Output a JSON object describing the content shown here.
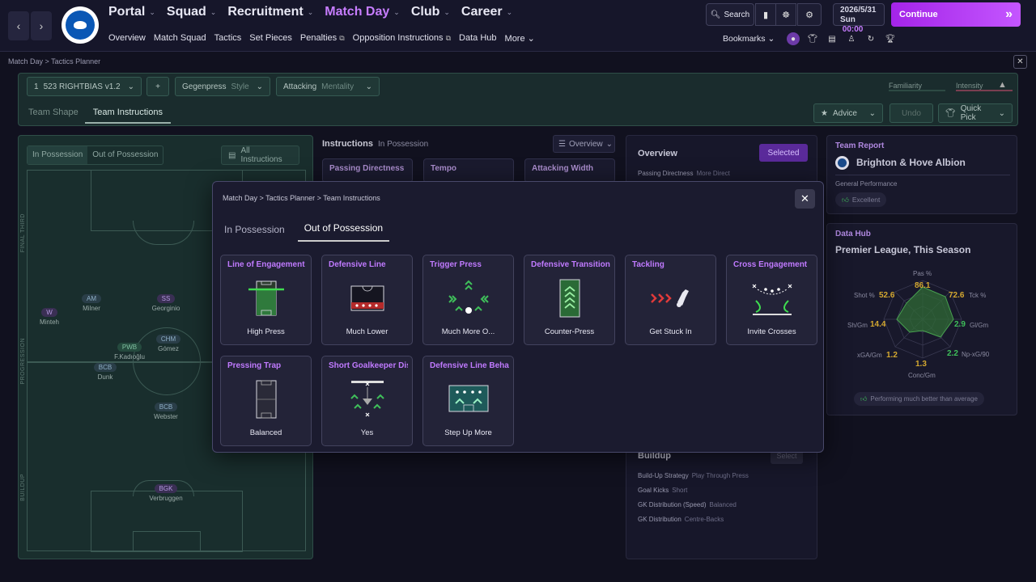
{
  "topnav": {
    "back": "‹",
    "forward": "›",
    "main": [
      {
        "label": "Portal",
        "active": false
      },
      {
        "label": "Squad",
        "active": false
      },
      {
        "label": "Recruitment",
        "active": false
      },
      {
        "label": "Match Day",
        "active": true
      },
      {
        "label": "Club",
        "active": false
      },
      {
        "label": "Career",
        "active": false
      }
    ],
    "sub": [
      "Overview",
      "Match Squad",
      "Tactics",
      "Set Pieces",
      "Penalties",
      "Opposition Instructions",
      "Data Hub",
      "More"
    ],
    "search_label": "Search",
    "date": "2026/5/31",
    "day": "Sun",
    "time": "00:00",
    "continue_label": "Continue",
    "bookmarks_label": "Bookmarks"
  },
  "breadcrumb_top": "Match Day  >  Tactics Planner",
  "planner": {
    "tactic_name": "523 RIGHTBIAS v1.2",
    "add": "+",
    "style_value": "Gegenpress",
    "style_label": "Style",
    "mentality_value": "Attacking",
    "mentality_label": "Mentality",
    "familiarity_label": "Familiarity",
    "intensity_label": "Intensity",
    "tabs": [
      "Team Shape",
      "Team Instructions"
    ],
    "advice_label": "Advice",
    "undo_label": "Undo",
    "quickpick_label": "Quick Pick"
  },
  "pitch": {
    "tabs": [
      "In Possession",
      "Out of Possession"
    ],
    "all_instructions": "All Instructions",
    "zones": [
      "FINAL THIRD",
      "PROGRESSION",
      "BUILDUP"
    ],
    "players": [
      {
        "pos": "W",
        "name": "Minteh"
      },
      {
        "pos": "AM",
        "name": "Milner"
      },
      {
        "pos": "SS",
        "name": "Georginio"
      },
      {
        "pos": "PWB",
        "name": "F.Kadıoğlu"
      },
      {
        "pos": "CHM",
        "name": "Gómez"
      },
      {
        "pos": "BCB",
        "name": "Dunk"
      },
      {
        "pos": "BCB",
        "name": "Webster"
      },
      {
        "pos": "BGK",
        "name": "Verbruggen"
      }
    ]
  },
  "instructions": {
    "title": "Instructions",
    "subtitle": "In Possession",
    "overview_dd": "Overview",
    "bg_cards": [
      "Passing Directness",
      "Tempo",
      "Attacking Width"
    ]
  },
  "overview": {
    "title": "Overview",
    "selected": "Selected",
    "line1_label": "Passing Directness",
    "line1_value": "More Direct",
    "buildup_title": "Buildup",
    "select": "Select",
    "lines": [
      {
        "label": "Build-Up Strategy",
        "value": "Play Through Press"
      },
      {
        "label": "Goal Kicks",
        "value": "Short"
      },
      {
        "label": "GK Distribution (Speed)",
        "value": "Balanced"
      },
      {
        "label": "GK Distribution",
        "value": "Centre-Backs"
      }
    ]
  },
  "team_report": {
    "title": "Team Report",
    "club": "Brighton & Hove Albion",
    "perf_label": "General Performance",
    "perf_value": "Excellent"
  },
  "data_hub": {
    "title": "Data Hub",
    "subtitle": "Premier League, This Season",
    "stats": [
      {
        "label": "Pas %",
        "value": "86.1"
      },
      {
        "label": "Tck %",
        "value": "72.6"
      },
      {
        "label": "Gl/Gm",
        "value": "2.9"
      },
      {
        "label": "Np-xG/90",
        "value": "2.2"
      },
      {
        "label": "Conc/Gm",
        "value": "1.3"
      },
      {
        "label": "xGA/Gm",
        "value": "1.2"
      },
      {
        "label": "Sh/Gm",
        "value": "14.4"
      },
      {
        "label": "Shot %",
        "value": "52.6"
      }
    ],
    "performance_note": "Performing much better than average"
  },
  "modal": {
    "crumbs": "Match Day  >  Tactics Planner  >  Team Instructions",
    "tabs": [
      "In Possession",
      "Out of Possession"
    ],
    "active_tab": 1,
    "cards": [
      {
        "title": "Line of Engagement",
        "value": "High Press",
        "icon": "line-of-engagement-icon"
      },
      {
        "title": "Defensive Line",
        "value": "Much Lower",
        "icon": "defensive-line-icon"
      },
      {
        "title": "Trigger Press",
        "value": "Much More O...",
        "icon": "trigger-press-icon"
      },
      {
        "title": "Defensive Transition",
        "value": "Counter-Press",
        "icon": "defensive-transition-icon"
      },
      {
        "title": "Tackling",
        "value": "Get Stuck In",
        "icon": "tackling-icon"
      },
      {
        "title": "Cross Engagement",
        "value": "Invite Crosses",
        "icon": "cross-engagement-icon"
      },
      {
        "title": "Pressing Trap",
        "value": "Balanced",
        "icon": "pressing-trap-icon"
      },
      {
        "title": "Short Goalkeeper Distri",
        "value": "Yes",
        "icon": "short-gk-distribution-icon"
      },
      {
        "title": "Defensive Line Behavic",
        "value": "Step Up More",
        "icon": "defensive-line-behaviour-icon"
      }
    ]
  },
  "colors": {
    "accent": "#c77dff",
    "continue_from": "#a424e8",
    "continue_to": "#c456ff",
    "pitch_bg": "#192e2d",
    "green_icon": "#3fbf5a"
  }
}
